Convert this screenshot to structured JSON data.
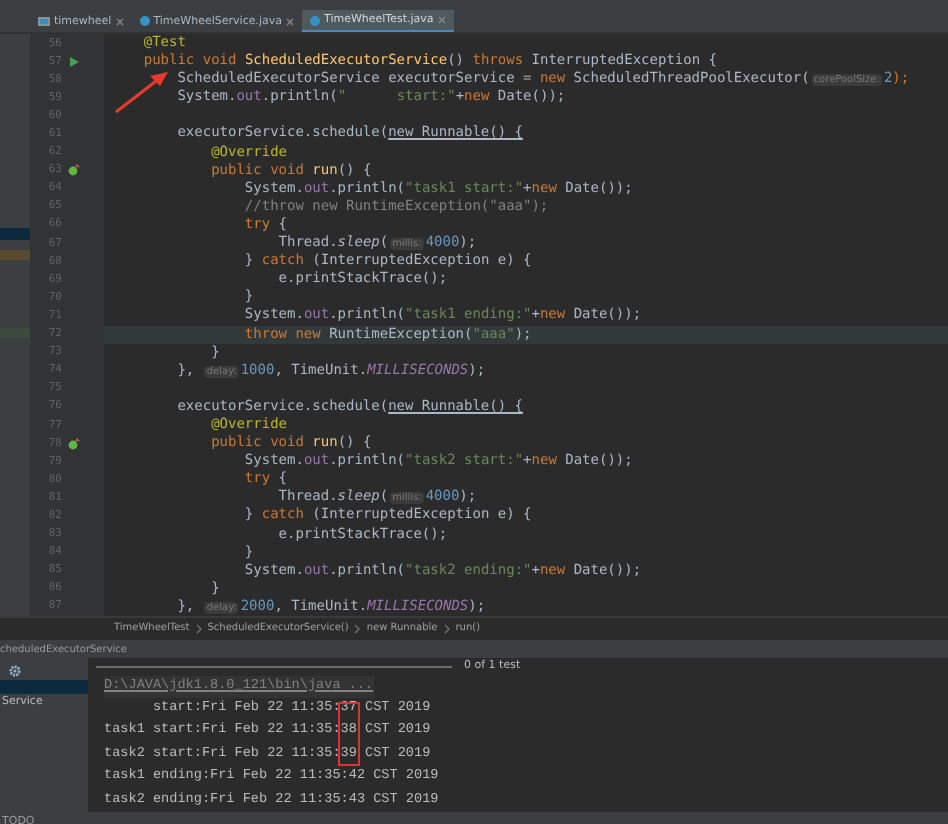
{
  "tabs": [
    {
      "label": "timewheel",
      "kind": "module",
      "selected": false
    },
    {
      "label": "TimeWheelService.java",
      "kind": "class",
      "selected": false
    },
    {
      "label": "TimeWheelTest.java",
      "kind": "class",
      "selected": true
    }
  ],
  "editor": {
    "lines": [
      {
        "number": "56",
        "kind": "plain",
        "highlighted": false,
        "code": [
          {
            "text": "    @Test",
            "kind": "annotation"
          }
        ]
      },
      {
        "number": "57",
        "kind": "run",
        "highlighted": false,
        "code": [
          {
            "text": "    public void ",
            "kind": "keyword"
          },
          {
            "text": "ScheduledExecutorService",
            "kind": "declaration"
          },
          {
            "text": "() ",
            "kind": "plain"
          },
          {
            "text": "throws ",
            "kind": "keyword"
          },
          {
            "text": "InterruptedException {",
            "kind": "plain"
          }
        ]
      },
      {
        "number": "58",
        "kind": "plain",
        "highlighted": false,
        "code": [
          {
            "text": "        ScheduledExecutorService executorService = ",
            "kind": "plain"
          },
          {
            "text": "new ",
            "kind": "keyword"
          },
          {
            "text": "ScheduledThreadPoolExecutor(",
            "kind": "plain"
          },
          {
            "text": "corePoolSize:",
            "kind": "hint"
          },
          {
            "text": "2",
            "kind": "number"
          },
          {
            "text": ");",
            "kind": "keyword"
          }
        ]
      },
      {
        "number": "59",
        "kind": "plain",
        "highlighted": false,
        "code": [
          {
            "text": "        System.",
            "kind": "plain"
          },
          {
            "text": "out",
            "kind": "field"
          },
          {
            "text": ".println(",
            "kind": "plain"
          },
          {
            "text": "\"      start:\"",
            "kind": "string"
          },
          {
            "text": "+",
            "kind": "plain"
          },
          {
            "text": "new ",
            "kind": "keyword"
          },
          {
            "text": "Date());",
            "kind": "plain"
          }
        ]
      },
      {
        "number": "60",
        "kind": "plain",
        "highlighted": false
      },
      {
        "number": "61",
        "kind": "plain",
        "highlighted": false,
        "code": [
          {
            "text": "        executorService.schedule(",
            "kind": "plain"
          },
          {
            "text": "new Runnable() {",
            "kind": "underline"
          }
        ]
      },
      {
        "number": "62",
        "kind": "plain",
        "highlighted": false,
        "code": [
          {
            "text": "            @Override",
            "kind": "annotation"
          }
        ]
      },
      {
        "number": "63",
        "kind": "override",
        "highlighted": false,
        "code": [
          {
            "text": "            public void ",
            "kind": "keyword"
          },
          {
            "text": "run",
            "kind": "declaration"
          },
          {
            "text": "() {",
            "kind": "plain"
          }
        ]
      },
      {
        "number": "64",
        "kind": "plain",
        "highlighted": false,
        "code": [
          {
            "text": "                System.",
            "kind": "plain"
          },
          {
            "text": "out",
            "kind": "field"
          },
          {
            "text": ".println(",
            "kind": "plain"
          },
          {
            "text": "\"task1 start:\"",
            "kind": "string"
          },
          {
            "text": "+",
            "kind": "plain"
          },
          {
            "text": "new ",
            "kind": "keyword"
          },
          {
            "text": "Date());",
            "kind": "plain"
          }
        ]
      },
      {
        "number": "65",
        "kind": "plain",
        "highlighted": false,
        "code": [
          {
            "text": "                //throw new RuntimeException(\"aaa\");",
            "kind": "comment"
          }
        ]
      },
      {
        "number": "66",
        "kind": "plain",
        "highlighted": false,
        "code": [
          {
            "text": "                try ",
            "kind": "keyword"
          },
          {
            "text": "{",
            "kind": "plain"
          }
        ]
      },
      {
        "number": "67",
        "kind": "plain",
        "highlighted": false,
        "code": [
          {
            "text": "                    Thread.",
            "kind": "plain"
          },
          {
            "text": "sleep",
            "kind": "static"
          },
          {
            "text": "(",
            "kind": "plain"
          },
          {
            "text": "millis:",
            "kind": "hint"
          },
          {
            "text": "4000",
            "kind": "number"
          },
          {
            "text": ");",
            "kind": "plain"
          }
        ]
      },
      {
        "number": "68",
        "kind": "plain",
        "highlighted": false,
        "code": [
          {
            "text": "                } ",
            "kind": "plain"
          },
          {
            "text": "catch ",
            "kind": "keyword"
          },
          {
            "text": "(InterruptedException e) {",
            "kind": "plain"
          }
        ]
      },
      {
        "number": "69",
        "kind": "plain",
        "highlighted": false,
        "code": [
          {
            "text": "                    e.printStackTrace();",
            "kind": "plain"
          }
        ]
      },
      {
        "number": "70",
        "kind": "plain",
        "highlighted": false,
        "code": [
          {
            "text": "                }",
            "kind": "plain"
          }
        ]
      },
      {
        "number": "71",
        "kind": "plain",
        "highlighted": false,
        "code": [
          {
            "text": "                System.",
            "kind": "plain"
          },
          {
            "text": "out",
            "kind": "field"
          },
          {
            "text": ".println(",
            "kind": "plain"
          },
          {
            "text": "\"task1 ending:\"",
            "kind": "string"
          },
          {
            "text": "+",
            "kind": "plain"
          },
          {
            "text": "new ",
            "kind": "keyword"
          },
          {
            "text": "Date());",
            "kind": "plain"
          }
        ]
      },
      {
        "number": "72",
        "kind": "plain",
        "highlighted": true,
        "code": [
          {
            "text": "                throw new ",
            "kind": "keyword"
          },
          {
            "text": "RuntimeException(",
            "kind": "plain"
          },
          {
            "text": "\"aaa\"",
            "kind": "string"
          },
          {
            "text": ");",
            "kind": "plain"
          }
        ]
      },
      {
        "number": "73",
        "kind": "plain",
        "highlighted": false,
        "code": [
          {
            "text": "            }",
            "kind": "plain"
          }
        ]
      },
      {
        "number": "74",
        "kind": "plain",
        "highlighted": false,
        "code": [
          {
            "text": "        }, ",
            "kind": "plain"
          },
          {
            "text": "delay:",
            "kind": "hint"
          },
          {
            "text": "1000",
            "kind": "number"
          },
          {
            "text": ", TimeUnit.",
            "kind": "plain"
          },
          {
            "text": "MILLISECONDS",
            "kind": "constant"
          },
          {
            "text": ");",
            "kind": "plain"
          }
        ]
      },
      {
        "number": "75",
        "kind": "plain",
        "highlighted": false
      },
      {
        "number": "76",
        "kind": "plain",
        "highlighted": false,
        "code": [
          {
            "text": "        executorService.schedule(",
            "kind": "plain"
          },
          {
            "text": "new Runnable() {",
            "kind": "underline"
          }
        ]
      },
      {
        "number": "77",
        "kind": "plain",
        "highlighted": false,
        "code": [
          {
            "text": "            @Override",
            "kind": "annotation"
          }
        ]
      },
      {
        "number": "78",
        "kind": "override",
        "highlighted": false,
        "code": [
          {
            "text": "            public void ",
            "kind": "keyword"
          },
          {
            "text": "run",
            "kind": "declaration"
          },
          {
            "text": "() {",
            "kind": "plain"
          }
        ]
      },
      {
        "number": "79",
        "kind": "plain",
        "highlighted": false,
        "code": [
          {
            "text": "                System.",
            "kind": "plain"
          },
          {
            "text": "out",
            "kind": "field"
          },
          {
            "text": ".println(",
            "kind": "plain"
          },
          {
            "text": "\"task2 start:\"",
            "kind": "string"
          },
          {
            "text": "+",
            "kind": "plain"
          },
          {
            "text": "new ",
            "kind": "keyword"
          },
          {
            "text": "Date());",
            "kind": "plain"
          }
        ]
      },
      {
        "number": "80",
        "kind": "plain",
        "highlighted": false,
        "code": [
          {
            "text": "                try ",
            "kind": "keyword"
          },
          {
            "text": "{",
            "kind": "plain"
          }
        ]
      },
      {
        "number": "81",
        "kind": "plain",
        "highlighted": false,
        "code": [
          {
            "text": "                    Thread.",
            "kind": "plain"
          },
          {
            "text": "sleep",
            "kind": "static"
          },
          {
            "text": "(",
            "kind": "plain"
          },
          {
            "text": "millis:",
            "kind": "hint"
          },
          {
            "text": "4000",
            "kind": "number"
          },
          {
            "text": ");",
            "kind": "plain"
          }
        ]
      },
      {
        "number": "82",
        "kind": "plain",
        "highlighted": false,
        "code": [
          {
            "text": "                } ",
            "kind": "plain"
          },
          {
            "text": "catch ",
            "kind": "keyword"
          },
          {
            "text": "(InterruptedException e) {",
            "kind": "plain"
          }
        ]
      },
      {
        "number": "83",
        "kind": "plain",
        "highlighted": false,
        "code": [
          {
            "text": "                    e.printStackTrace();",
            "kind": "plain"
          }
        ]
      },
      {
        "number": "84",
        "kind": "plain",
        "highlighted": false,
        "code": [
          {
            "text": "                }",
            "kind": "plain"
          }
        ]
      },
      {
        "number": "85",
        "kind": "plain",
        "highlighted": false,
        "code": [
          {
            "text": "                System.",
            "kind": "plain"
          },
          {
            "text": "out",
            "kind": "field"
          },
          {
            "text": ".println(",
            "kind": "plain"
          },
          {
            "text": "\"task2 ending:\"",
            "kind": "string"
          },
          {
            "text": "+",
            "kind": "plain"
          },
          {
            "text": "new ",
            "kind": "keyword"
          },
          {
            "text": "Date());",
            "kind": "plain"
          }
        ]
      },
      {
        "number": "86",
        "kind": "plain",
        "highlighted": false,
        "code": [
          {
            "text": "            }",
            "kind": "plain"
          }
        ]
      },
      {
        "number": "87",
        "kind": "plain",
        "highlighted": false,
        "code": [
          {
            "text": "        }, ",
            "kind": "plain"
          },
          {
            "text": "delay:",
            "kind": "hint"
          },
          {
            "text": "2000",
            "kind": "number"
          },
          {
            "text": ", TimeUnit.",
            "kind": "plain"
          },
          {
            "text": "MILLISECONDS",
            "kind": "constant"
          },
          {
            "text": ");",
            "kind": "plain"
          }
        ]
      }
    ]
  },
  "breadcrumb": [
    "TimeWheelTest",
    "ScheduledExecutorService()",
    "new Runnable",
    "run()"
  ],
  "run_panel": {
    "title": "cheduledExecutorService",
    "tree": [
      {
        "selected": true
      },
      {
        "label": "Service",
        "selected": false
      }
    ],
    "progress": {
      "level": 0,
      "label": "0 of 1 test"
    },
    "console": [
      {
        "kind": "command",
        "text": "D:\\JAVA\\jdk1.8.0_121\\bin\\java ..."
      },
      {
        "kind": "output",
        "text": "      start:Fri Feb 22 11:35:37 CST 2019"
      },
      {
        "kind": "output",
        "text": "task1 start:Fri Feb 22 11:35:38 CST 2019"
      },
      {
        "kind": "output",
        "text": "task2 start:Fri Feb 22 11:35:39 CST 2019"
      },
      {
        "kind": "output",
        "text": "task1 ending:Fri Feb 22 11:35:42 CST 2019"
      },
      {
        "kind": "output",
        "text": "task2 ending:Fri Feb 22 11:35:43 CST 2019"
      }
    ]
  },
  "status_bar": {
    "label": "TODO"
  }
}
